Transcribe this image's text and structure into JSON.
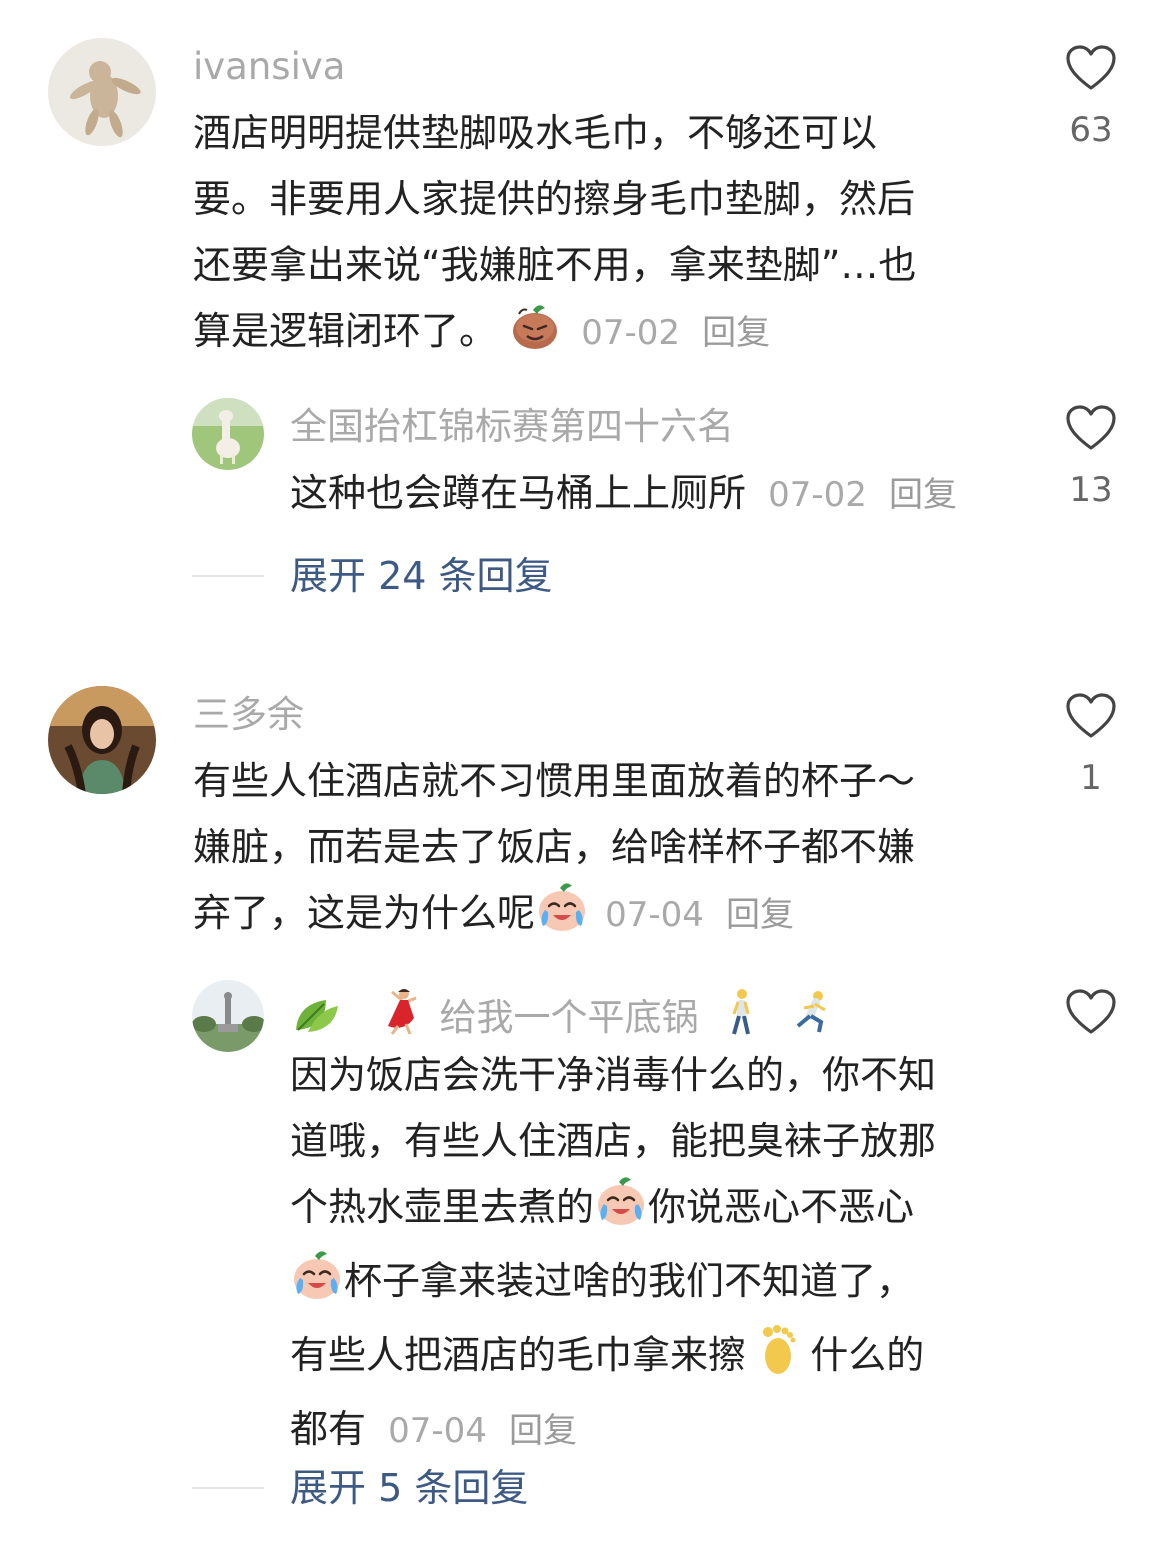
{
  "comments": [
    {
      "username": "ivansiva",
      "lines": [
        "酒店明明提供垫脚吸水毛巾，不够还可以",
        "要。非要用人家提供的擦身毛巾垫脚，然后",
        "还要拿出来说“我嫌脏不用，拿来垫脚”…也",
        "算是逻辑闭环了。"
      ],
      "date": "07-02",
      "reply_label": "回复",
      "likes": "63",
      "replies": [
        {
          "username": "全国抬杠锦标赛第四十六名",
          "lines": [
            "这种也会蹲在马桶上上厕所"
          ],
          "date": "07-02",
          "reply_label": "回复",
          "likes": "13"
        }
      ],
      "expand_label": "展开 24 条回复"
    },
    {
      "username": "三多余",
      "lines": [
        "有些人住酒店就不习惯用里面放着的杯子～",
        "嫌脏，而若是去了饭店，给啥样杯子都不嫌",
        "弃了，这是为什么呢"
      ],
      "date": "07-04",
      "reply_label": "回复",
      "likes": "1",
      "replies": [
        {
          "username": "给我一个平底锅",
          "lines": [
            "因为饭店会洗干净消毒什么的，你不知",
            "道哦，有些人住酒店，能把臭袜子放那",
            "个热水壶里去煮的",
            "你说恶心不恶心",
            "杯子拿来装过啥的我们不知道了，",
            "有些人把酒店的毛巾拿来擦",
            "什么的",
            "都有"
          ],
          "date": "07-04",
          "reply_label": "回复",
          "likes": ""
        }
      ],
      "expand_label": "展开 5 条回复"
    }
  ],
  "icons": {
    "like": "heart-outline-icon",
    "emoji_grimace": "grimace-bean-emoji-icon",
    "emoji_cry": "crying-laugh-emoji-icon",
    "emoji_leaf": "leaf-emoji-icon",
    "emoji_dancer": "dancer-emoji-icon",
    "emoji_walk": "walking-person-emoji-icon",
    "emoji_run": "running-person-emoji-icon",
    "emoji_foot": "foot-emoji-icon"
  },
  "colors": {
    "username": "#a9a9a9",
    "text": "#222222",
    "link": "#3c5a83",
    "meta": "#a9a9a9"
  }
}
